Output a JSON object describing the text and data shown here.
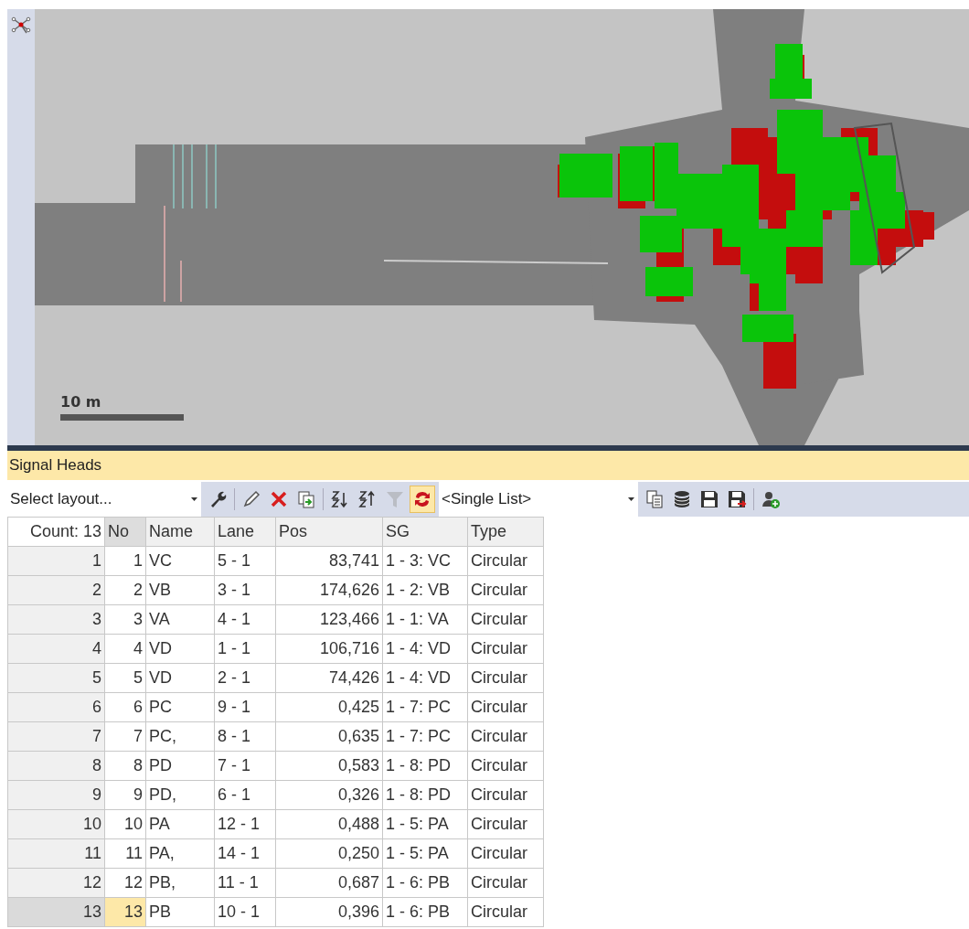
{
  "map": {
    "scale_label": "10 m"
  },
  "panel": {
    "title": "Signal Heads"
  },
  "toolbar": {
    "layout_select": "Select layout...",
    "list_select": "<Single List>",
    "tools_left": [
      {
        "kind": "wrench",
        "on": false,
        "disabled": false
      },
      {
        "kind": "sep"
      },
      {
        "kind": "pencil",
        "on": false,
        "disabled": false
      },
      {
        "kind": "delete",
        "on": false,
        "disabled": false
      },
      {
        "kind": "duplicate",
        "on": false,
        "disabled": false
      },
      {
        "kind": "sep"
      },
      {
        "kind": "sort-asc",
        "on": false,
        "disabled": false
      },
      {
        "kind": "sort-desc",
        "on": false,
        "disabled": false
      },
      {
        "kind": "filter",
        "on": false,
        "disabled": true
      },
      {
        "kind": "sync",
        "on": true,
        "disabled": false
      }
    ],
    "tools_right": [
      {
        "kind": "copy",
        "on": false,
        "disabled": false
      },
      {
        "kind": "database",
        "on": false,
        "disabled": false
      },
      {
        "kind": "save",
        "on": false,
        "disabled": false
      },
      {
        "kind": "save-as",
        "on": false,
        "disabled": false
      },
      {
        "kind": "sep"
      },
      {
        "kind": "user-add",
        "on": false,
        "disabled": false
      }
    ]
  },
  "table": {
    "count": "Count: 13",
    "columns": [
      "No",
      "Name",
      "Lane",
      "Pos",
      "SG",
      "Type"
    ],
    "rows": [
      {
        "index": "1",
        "cells": [
          "1",
          "VC",
          "5 - 1",
          "83,741",
          "1 - 3: VC",
          "Circular"
        ],
        "selected": false
      },
      {
        "index": "2",
        "cells": [
          "2",
          "VB",
          "3 - 1",
          "174,626",
          "1 - 2: VB",
          "Circular"
        ],
        "selected": false
      },
      {
        "index": "3",
        "cells": [
          "3",
          "VA",
          "4 - 1",
          "123,466",
          "1 - 1: VA",
          "Circular"
        ],
        "selected": false
      },
      {
        "index": "4",
        "cells": [
          "4",
          "VD",
          "1 - 1",
          "106,716",
          "1 - 4: VD",
          "Circular"
        ],
        "selected": false
      },
      {
        "index": "5",
        "cells": [
          "5",
          "VD",
          "2 - 1",
          "74,426",
          "1 - 4: VD",
          "Circular"
        ],
        "selected": false
      },
      {
        "index": "6",
        "cells": [
          "6",
          "PC",
          "9 - 1",
          "0,425",
          "1 - 7: PC",
          "Circular"
        ],
        "selected": false
      },
      {
        "index": "7",
        "cells": [
          "7",
          "PC,",
          "8 - 1",
          "0,635",
          "1 - 7: PC",
          "Circular"
        ],
        "selected": false
      },
      {
        "index": "8",
        "cells": [
          "8",
          "PD",
          "7 - 1",
          "0,583",
          "1 - 8: PD",
          "Circular"
        ],
        "selected": false
      },
      {
        "index": "9",
        "cells": [
          "9",
          "PD,",
          "6 - 1",
          "0,326",
          "1 - 8: PD",
          "Circular"
        ],
        "selected": false
      },
      {
        "index": "10",
        "cells": [
          "10",
          "PA",
          "12 - 1",
          "0,488",
          "1 - 5: PA",
          "Circular"
        ],
        "selected": false
      },
      {
        "index": "11",
        "cells": [
          "11",
          "PA,",
          "14 - 1",
          "0,250",
          "1 - 5: PA",
          "Circular"
        ],
        "selected": false
      },
      {
        "index": "12",
        "cells": [
          "12",
          "PB,",
          "11 - 1",
          "0,687",
          "1 - 6: PB",
          "Circular"
        ],
        "selected": false
      },
      {
        "index": "13",
        "cells": [
          "13",
          "PB",
          "10 - 1",
          "0,396",
          "1 - 6: PB",
          "Circular"
        ],
        "selected": true
      }
    ]
  }
}
